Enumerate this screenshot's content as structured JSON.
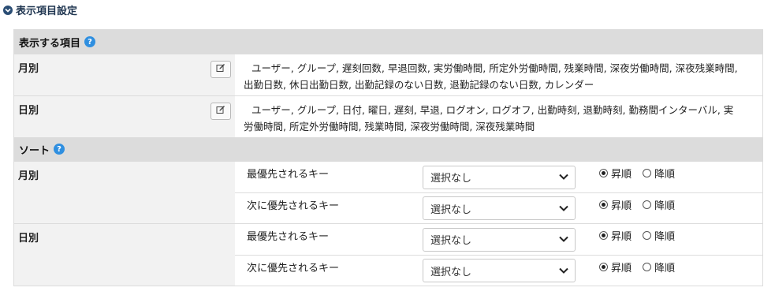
{
  "section": {
    "title": "表示項目設定",
    "toggle_icon": "chevron-down-circle-icon"
  },
  "display_items": {
    "header": "表示する項目",
    "rows": [
      {
        "label": "月別",
        "value_line1": "ユーザー, グループ, 遅刻回数, 早退回数, 実労働時間, 所定外労働時間, 残業時間, 深夜労働時間, 深夜残業時間,",
        "value_line2": "出勤日数, 休日出勤日数, 出勤記録のない日数, 退勤記録のない日数, カレンダー"
      },
      {
        "label": "日別",
        "value_line1": "ユーザー, グループ, 日付, 曜日, 遅刻, 早退, ログオン, ログオフ, 出勤時刻, 退勤時刻, 勤務間インターバル, 実",
        "value_line2": "労働時間, 所定外労働時間, 残業時間, 深夜労働時間, 深夜残業時間"
      }
    ]
  },
  "sort": {
    "header": "ソート",
    "blocks": [
      {
        "label": "月別",
        "keys": [
          {
            "key_label": "最優先されるキー",
            "selected": "選択なし",
            "asc": "昇順",
            "desc": "降順",
            "order": "asc"
          },
          {
            "key_label": "次に優先されるキー",
            "selected": "選択なし",
            "asc": "昇順",
            "desc": "降順",
            "order": "asc"
          }
        ]
      },
      {
        "label": "日別",
        "keys": [
          {
            "key_label": "最優先されるキー",
            "selected": "選択なし",
            "asc": "昇順",
            "desc": "降順",
            "order": "asc"
          },
          {
            "key_label": "次に優先されるキー",
            "selected": "選択なし",
            "asc": "昇順",
            "desc": "降順",
            "order": "asc"
          }
        ]
      }
    ]
  },
  "colors": {
    "header_bg": "#dcdcdc",
    "label_bg": "#f2f2f2",
    "help_icon": "#2f8fe0",
    "section_title": "#1f3550"
  }
}
